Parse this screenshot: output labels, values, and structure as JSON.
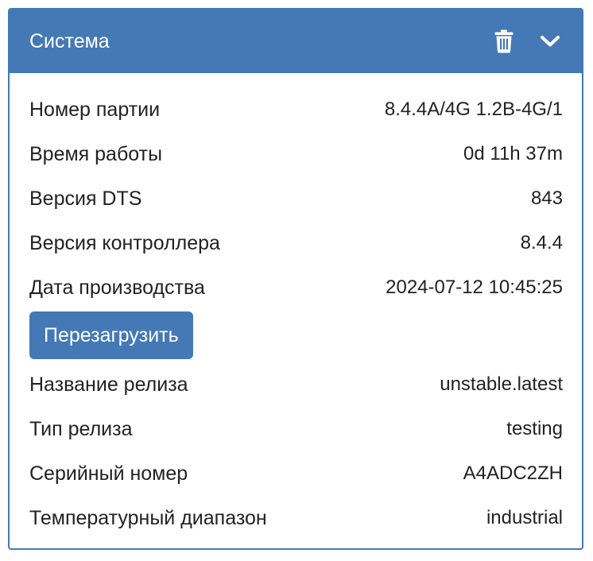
{
  "panel": {
    "title": "Система",
    "icons": {
      "delete": "trash-icon",
      "collapse": "chevron-down-icon"
    },
    "colors": {
      "accent": "#4479b5",
      "text": "#222222",
      "header_text": "#ffffff"
    }
  },
  "rows_top": [
    {
      "label": "Номер партии",
      "value": "8.4.4A/4G 1.2B-4G/1"
    },
    {
      "label": "Время работы",
      "value": "0d 11h 37m"
    },
    {
      "label": "Версия DTS",
      "value": "843"
    },
    {
      "label": "Версия контроллера",
      "value": "8.4.4"
    },
    {
      "label": "Дата производства",
      "value": "2024-07-12 10:45:25"
    }
  ],
  "reboot_button": {
    "label": "Перезагрузить"
  },
  "rows_bottom": [
    {
      "label": "Название релиза",
      "value": "unstable.latest"
    },
    {
      "label": "Тип релиза",
      "value": "testing"
    },
    {
      "label": "Серийный номер",
      "value": "A4ADC2ZH"
    },
    {
      "label": "Температурный диапазон",
      "value": "industrial"
    }
  ]
}
